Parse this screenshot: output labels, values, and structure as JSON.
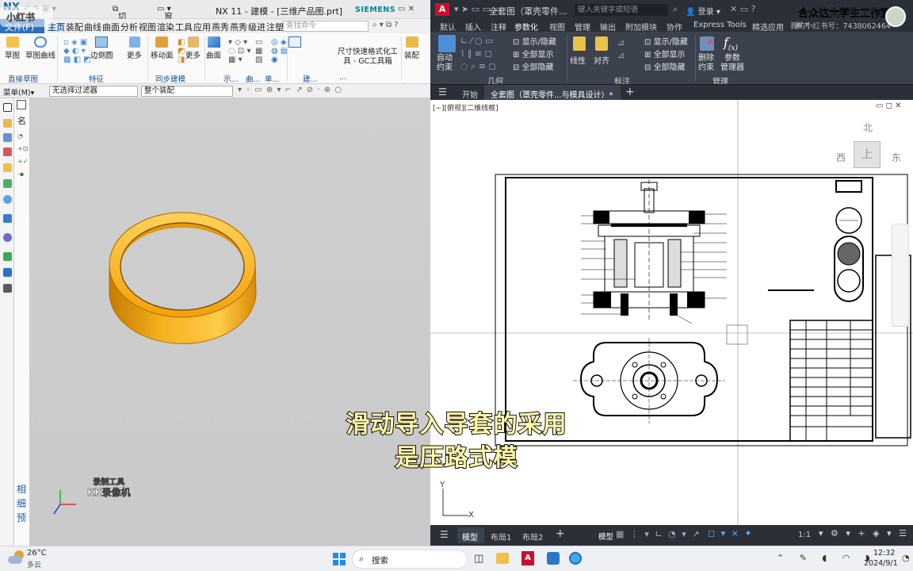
{
  "nx": {
    "app_logo": "NX",
    "quick_switch": "切换窗口",
    "window_menu": "窗口",
    "title": "NX 11 - 建模 - [三维产品图.prt]",
    "vendor": "SIEMENS",
    "file_tab": "文件(F)",
    "tabs": [
      "主页",
      "装配",
      "曲线",
      "曲面",
      "分析",
      "视图",
      "渲染",
      "工具",
      "应用",
      "燕秀",
      "燕秀",
      "级进",
      "注塑"
    ],
    "search_placeholder": "查找命令",
    "ribbon_buttons": [
      "草图",
      "草图曲线",
      "边倒圆",
      "更多",
      "移动面",
      "更多",
      "曲面",
      "尺寸快速格式化工",
      "具 - GC工具箱",
      "装配"
    ],
    "ribbon_groups": [
      "直接草图",
      "特征",
      "同步建模",
      "示...",
      "曲...",
      "单...",
      "建...",
      "..."
    ],
    "menu_label": "菜单(M)▾",
    "filter_value": "无选择过滤器",
    "assembly_value": "整个装配",
    "nav_letter": "名",
    "side_labels": [
      "相",
      "细",
      "预"
    ],
    "model_color": "#f2a10a"
  },
  "watermarks": {
    "xiaohongshu": "小红书",
    "recorder_line1": "录制工具",
    "recorder_line2": "KK录像机"
  },
  "cad": {
    "app_letter": "A",
    "doc_title": "全套图（罩壳零件...",
    "search_placeholder": "键入关键字或短语",
    "login": "登录",
    "studio": "合众达大学生工作室",
    "redbook_id": "我的小红书号：7438062464",
    "menus": [
      "默认",
      "插入",
      "注释",
      "参数化",
      "视图",
      "管理",
      "输出",
      "附加模块",
      "协作",
      "Express Tools",
      "精选应用"
    ],
    "active_menu": "参数化",
    "ribbon": {
      "auto_constrain": "自动",
      "auto_constrain2": "约束",
      "show_hide": "显示/隐藏",
      "show_all": "全部显示",
      "hide_all": "全部隐藏",
      "linear": "线性",
      "aligned": "对齐",
      "show_hide2": "显示/隐藏",
      "show_all2": "全部显示",
      "hide_all2": "全部隐藏",
      "delete_constraints": "删除",
      "delete_constraints2": "约束",
      "parameters": "参数",
      "parameters2": "管理器"
    },
    "groups": [
      "几何",
      "标注",
      "管理"
    ],
    "file_tabs": [
      "开始",
      "全套图（罩壳零件...与模具设计）*"
    ],
    "viewport_label": "[−][俯视][二维线框]",
    "viewcube": {
      "north": "北",
      "south": "上",
      "west": "西",
      "east": "东"
    },
    "layout_tabs": [
      "模型",
      "布局1",
      "布局2"
    ],
    "status_model": "模型",
    "scale": "1:1"
  },
  "subtitle": {
    "line1": "滑动导入导套的采用",
    "line2": "是压路式模"
  },
  "taskbar": {
    "temperature": "26°C",
    "weather": "多云",
    "search": "搜索",
    "time": "12:32",
    "date": "2024/9/1"
  }
}
